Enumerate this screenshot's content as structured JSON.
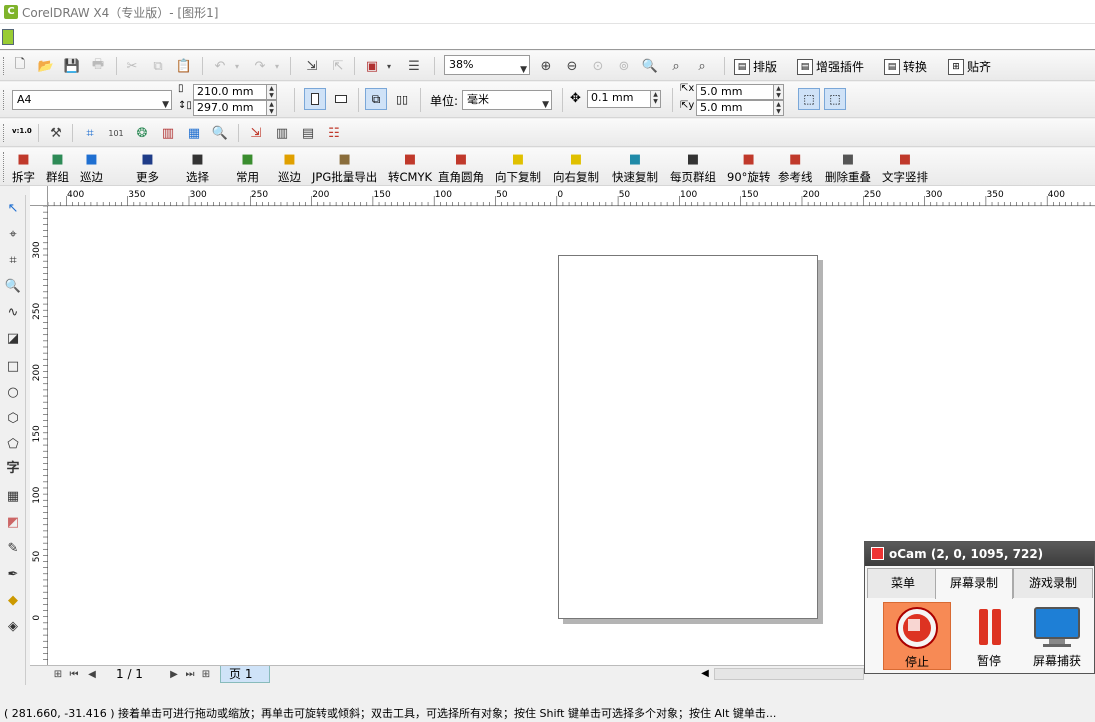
{
  "window": {
    "title": "CorelDRAW X4（专业版）- [图形1]",
    "app_icon": "coreldraw-icon"
  },
  "std_toolbar": {
    "zoom_value": "38%",
    "plugins": [
      {
        "label": "排版",
        "icon": "layout-icon"
      },
      {
        "label": "增强插件",
        "icon": "plugin-icon"
      },
      {
        "label": "转换",
        "icon": "convert-icon"
      },
      {
        "label": "贴齐",
        "icon": "snap-icon"
      }
    ]
  },
  "property_bar": {
    "paper_size": "A4",
    "width": "210.0 mm",
    "height": "297.0 mm",
    "unit_label": "单位:",
    "unit_value": "毫米",
    "nudge": "0.1 mm",
    "dup_x": "5.0 mm",
    "dup_y": "5.0 mm"
  },
  "version_badge": "v:1.0",
  "plugin_bar": [
    {
      "label": "拆字",
      "icon": "split-text-icon",
      "color": "#c0392b"
    },
    {
      "label": "群组",
      "icon": "group-icon",
      "color": "#2e8b57"
    },
    {
      "label": "巡边",
      "icon": "outline-icon",
      "color": "#1f6fd1"
    },
    {
      "label": "更多",
      "icon": "more-icon",
      "color": "#1f3c88"
    },
    {
      "label": "选择",
      "icon": "select-icon",
      "color": "#333333"
    },
    {
      "label": "常用",
      "icon": "gear-icon",
      "color": "#3a8d2f"
    },
    {
      "label": "巡边",
      "icon": "outline2-icon",
      "color": "#e0a000"
    },
    {
      "label": "JPG批量导出",
      "icon": "jpg-export-icon",
      "color": "#8a6d3b"
    },
    {
      "label": "转CMYK",
      "icon": "cmyk-icon",
      "color": "#c0392b"
    },
    {
      "label": "直角圆角",
      "icon": "corner-icon",
      "color": "#c0392b"
    },
    {
      "label": "向下复制",
      "icon": "copy-down-icon",
      "color": "#e0c000"
    },
    {
      "label": "向右复制",
      "icon": "copy-right-icon",
      "color": "#e0c000"
    },
    {
      "label": "快速复制",
      "icon": "quick-copy-icon",
      "color": "#1f8aa8"
    },
    {
      "label": "每页群组",
      "icon": "page-group-icon",
      "color": "#333333"
    },
    {
      "label": "90°旋转",
      "icon": "rotate-icon",
      "color": "#c0392b"
    },
    {
      "label": "参考线",
      "icon": "guideline-icon",
      "color": "#c0392b"
    },
    {
      "label": "删除重叠",
      "icon": "delete-overlap-icon",
      "color": "#555555"
    },
    {
      "label": "文字竖排",
      "icon": "vertical-text-icon",
      "color": "#c0392b"
    }
  ],
  "hruler": [
    "400",
    "350",
    "300",
    "250",
    "200",
    "150",
    "100",
    "50",
    "0",
    "50",
    "100",
    "150",
    "200",
    "250",
    "300",
    "350",
    "400"
  ],
  "vruler": [
    "300",
    "250",
    "200",
    "150",
    "100",
    "50",
    "0"
  ],
  "pagebar": {
    "page_count": "1 / 1",
    "page_tab": "页 1"
  },
  "status": {
    "coords": "( 281.660, -31.416 )",
    "hint": "接着单击可进行拖动或缩放；再单击可旋转或倾斜；双击工具，可选择所有对象；按住 Shift 键单击可选择多个对象；按住 Alt 键单击..."
  },
  "ocam": {
    "title": "oCam (2, 0, 1095, 722)",
    "tabs": [
      "菜单",
      "屏幕录制",
      "游戏录制"
    ],
    "buttons": [
      "停止",
      "暂停",
      "屏幕捕获"
    ]
  }
}
